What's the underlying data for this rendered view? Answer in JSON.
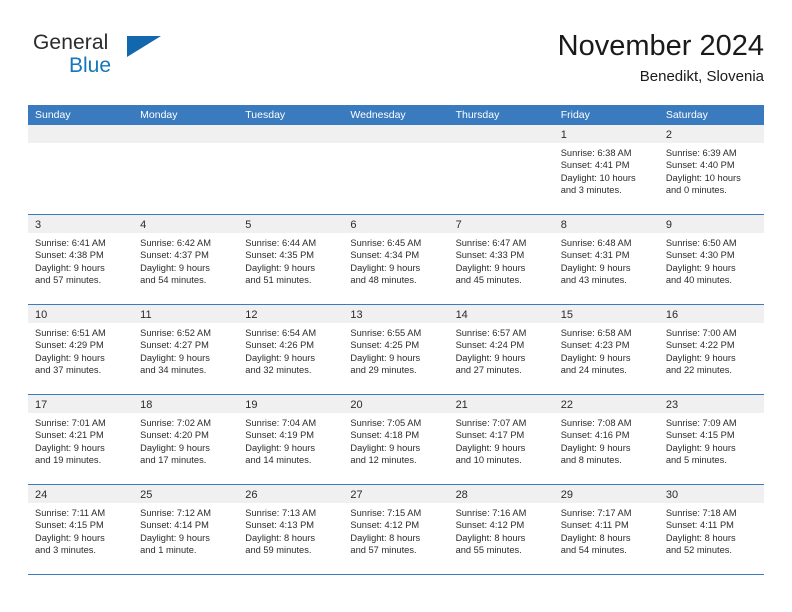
{
  "brand": {
    "name_part1": "General",
    "name_part2": "Blue",
    "logo_icon": "triangle-logo-icon"
  },
  "header": {
    "title": "November 2024",
    "subtitle": "Benedikt, Slovenia"
  },
  "calendar": {
    "weekdays": [
      "Sunday",
      "Monday",
      "Tuesday",
      "Wednesday",
      "Thursday",
      "Friday",
      "Saturday"
    ],
    "accent_color": "#3a7bc0",
    "daynum_band_color": "#f0f0f0",
    "weeks": [
      [
        {
          "day": "",
          "sunrise": "",
          "sunset": "",
          "daylight_line1": "",
          "daylight_line2": ""
        },
        {
          "day": "",
          "sunrise": "",
          "sunset": "",
          "daylight_line1": "",
          "daylight_line2": ""
        },
        {
          "day": "",
          "sunrise": "",
          "sunset": "",
          "daylight_line1": "",
          "daylight_line2": ""
        },
        {
          "day": "",
          "sunrise": "",
          "sunset": "",
          "daylight_line1": "",
          "daylight_line2": ""
        },
        {
          "day": "",
          "sunrise": "",
          "sunset": "",
          "daylight_line1": "",
          "daylight_line2": ""
        },
        {
          "day": "1",
          "sunrise": "Sunrise: 6:38 AM",
          "sunset": "Sunset: 4:41 PM",
          "daylight_line1": "Daylight: 10 hours",
          "daylight_line2": "and 3 minutes."
        },
        {
          "day": "2",
          "sunrise": "Sunrise: 6:39 AM",
          "sunset": "Sunset: 4:40 PM",
          "daylight_line1": "Daylight: 10 hours",
          "daylight_line2": "and 0 minutes."
        }
      ],
      [
        {
          "day": "3",
          "sunrise": "Sunrise: 6:41 AM",
          "sunset": "Sunset: 4:38 PM",
          "daylight_line1": "Daylight: 9 hours",
          "daylight_line2": "and 57 minutes."
        },
        {
          "day": "4",
          "sunrise": "Sunrise: 6:42 AM",
          "sunset": "Sunset: 4:37 PM",
          "daylight_line1": "Daylight: 9 hours",
          "daylight_line2": "and 54 minutes."
        },
        {
          "day": "5",
          "sunrise": "Sunrise: 6:44 AM",
          "sunset": "Sunset: 4:35 PM",
          "daylight_line1": "Daylight: 9 hours",
          "daylight_line2": "and 51 minutes."
        },
        {
          "day": "6",
          "sunrise": "Sunrise: 6:45 AM",
          "sunset": "Sunset: 4:34 PM",
          "daylight_line1": "Daylight: 9 hours",
          "daylight_line2": "and 48 minutes."
        },
        {
          "day": "7",
          "sunrise": "Sunrise: 6:47 AM",
          "sunset": "Sunset: 4:33 PM",
          "daylight_line1": "Daylight: 9 hours",
          "daylight_line2": "and 45 minutes."
        },
        {
          "day": "8",
          "sunrise": "Sunrise: 6:48 AM",
          "sunset": "Sunset: 4:31 PM",
          "daylight_line1": "Daylight: 9 hours",
          "daylight_line2": "and 43 minutes."
        },
        {
          "day": "9",
          "sunrise": "Sunrise: 6:50 AM",
          "sunset": "Sunset: 4:30 PM",
          "daylight_line1": "Daylight: 9 hours",
          "daylight_line2": "and 40 minutes."
        }
      ],
      [
        {
          "day": "10",
          "sunrise": "Sunrise: 6:51 AM",
          "sunset": "Sunset: 4:29 PM",
          "daylight_line1": "Daylight: 9 hours",
          "daylight_line2": "and 37 minutes."
        },
        {
          "day": "11",
          "sunrise": "Sunrise: 6:52 AM",
          "sunset": "Sunset: 4:27 PM",
          "daylight_line1": "Daylight: 9 hours",
          "daylight_line2": "and 34 minutes."
        },
        {
          "day": "12",
          "sunrise": "Sunrise: 6:54 AM",
          "sunset": "Sunset: 4:26 PM",
          "daylight_line1": "Daylight: 9 hours",
          "daylight_line2": "and 32 minutes."
        },
        {
          "day": "13",
          "sunrise": "Sunrise: 6:55 AM",
          "sunset": "Sunset: 4:25 PM",
          "daylight_line1": "Daylight: 9 hours",
          "daylight_line2": "and 29 minutes."
        },
        {
          "day": "14",
          "sunrise": "Sunrise: 6:57 AM",
          "sunset": "Sunset: 4:24 PM",
          "daylight_line1": "Daylight: 9 hours",
          "daylight_line2": "and 27 minutes."
        },
        {
          "day": "15",
          "sunrise": "Sunrise: 6:58 AM",
          "sunset": "Sunset: 4:23 PM",
          "daylight_line1": "Daylight: 9 hours",
          "daylight_line2": "and 24 minutes."
        },
        {
          "day": "16",
          "sunrise": "Sunrise: 7:00 AM",
          "sunset": "Sunset: 4:22 PM",
          "daylight_line1": "Daylight: 9 hours",
          "daylight_line2": "and 22 minutes."
        }
      ],
      [
        {
          "day": "17",
          "sunrise": "Sunrise: 7:01 AM",
          "sunset": "Sunset: 4:21 PM",
          "daylight_line1": "Daylight: 9 hours",
          "daylight_line2": "and 19 minutes."
        },
        {
          "day": "18",
          "sunrise": "Sunrise: 7:02 AM",
          "sunset": "Sunset: 4:20 PM",
          "daylight_line1": "Daylight: 9 hours",
          "daylight_line2": "and 17 minutes."
        },
        {
          "day": "19",
          "sunrise": "Sunrise: 7:04 AM",
          "sunset": "Sunset: 4:19 PM",
          "daylight_line1": "Daylight: 9 hours",
          "daylight_line2": "and 14 minutes."
        },
        {
          "day": "20",
          "sunrise": "Sunrise: 7:05 AM",
          "sunset": "Sunset: 4:18 PM",
          "daylight_line1": "Daylight: 9 hours",
          "daylight_line2": "and 12 minutes."
        },
        {
          "day": "21",
          "sunrise": "Sunrise: 7:07 AM",
          "sunset": "Sunset: 4:17 PM",
          "daylight_line1": "Daylight: 9 hours",
          "daylight_line2": "and 10 minutes."
        },
        {
          "day": "22",
          "sunrise": "Sunrise: 7:08 AM",
          "sunset": "Sunset: 4:16 PM",
          "daylight_line1": "Daylight: 9 hours",
          "daylight_line2": "and 8 minutes."
        },
        {
          "day": "23",
          "sunrise": "Sunrise: 7:09 AM",
          "sunset": "Sunset: 4:15 PM",
          "daylight_line1": "Daylight: 9 hours",
          "daylight_line2": "and 5 minutes."
        }
      ],
      [
        {
          "day": "24",
          "sunrise": "Sunrise: 7:11 AM",
          "sunset": "Sunset: 4:15 PM",
          "daylight_line1": "Daylight: 9 hours",
          "daylight_line2": "and 3 minutes."
        },
        {
          "day": "25",
          "sunrise": "Sunrise: 7:12 AM",
          "sunset": "Sunset: 4:14 PM",
          "daylight_line1": "Daylight: 9 hours",
          "daylight_line2": "and 1 minute."
        },
        {
          "day": "26",
          "sunrise": "Sunrise: 7:13 AM",
          "sunset": "Sunset: 4:13 PM",
          "daylight_line1": "Daylight: 8 hours",
          "daylight_line2": "and 59 minutes."
        },
        {
          "day": "27",
          "sunrise": "Sunrise: 7:15 AM",
          "sunset": "Sunset: 4:12 PM",
          "daylight_line1": "Daylight: 8 hours",
          "daylight_line2": "and 57 minutes."
        },
        {
          "day": "28",
          "sunrise": "Sunrise: 7:16 AM",
          "sunset": "Sunset: 4:12 PM",
          "daylight_line1": "Daylight: 8 hours",
          "daylight_line2": "and 55 minutes."
        },
        {
          "day": "29",
          "sunrise": "Sunrise: 7:17 AM",
          "sunset": "Sunset: 4:11 PM",
          "daylight_line1": "Daylight: 8 hours",
          "daylight_line2": "and 54 minutes."
        },
        {
          "day": "30",
          "sunrise": "Sunrise: 7:18 AM",
          "sunset": "Sunset: 4:11 PM",
          "daylight_line1": "Daylight: 8 hours",
          "daylight_line2": "and 52 minutes."
        }
      ]
    ]
  }
}
